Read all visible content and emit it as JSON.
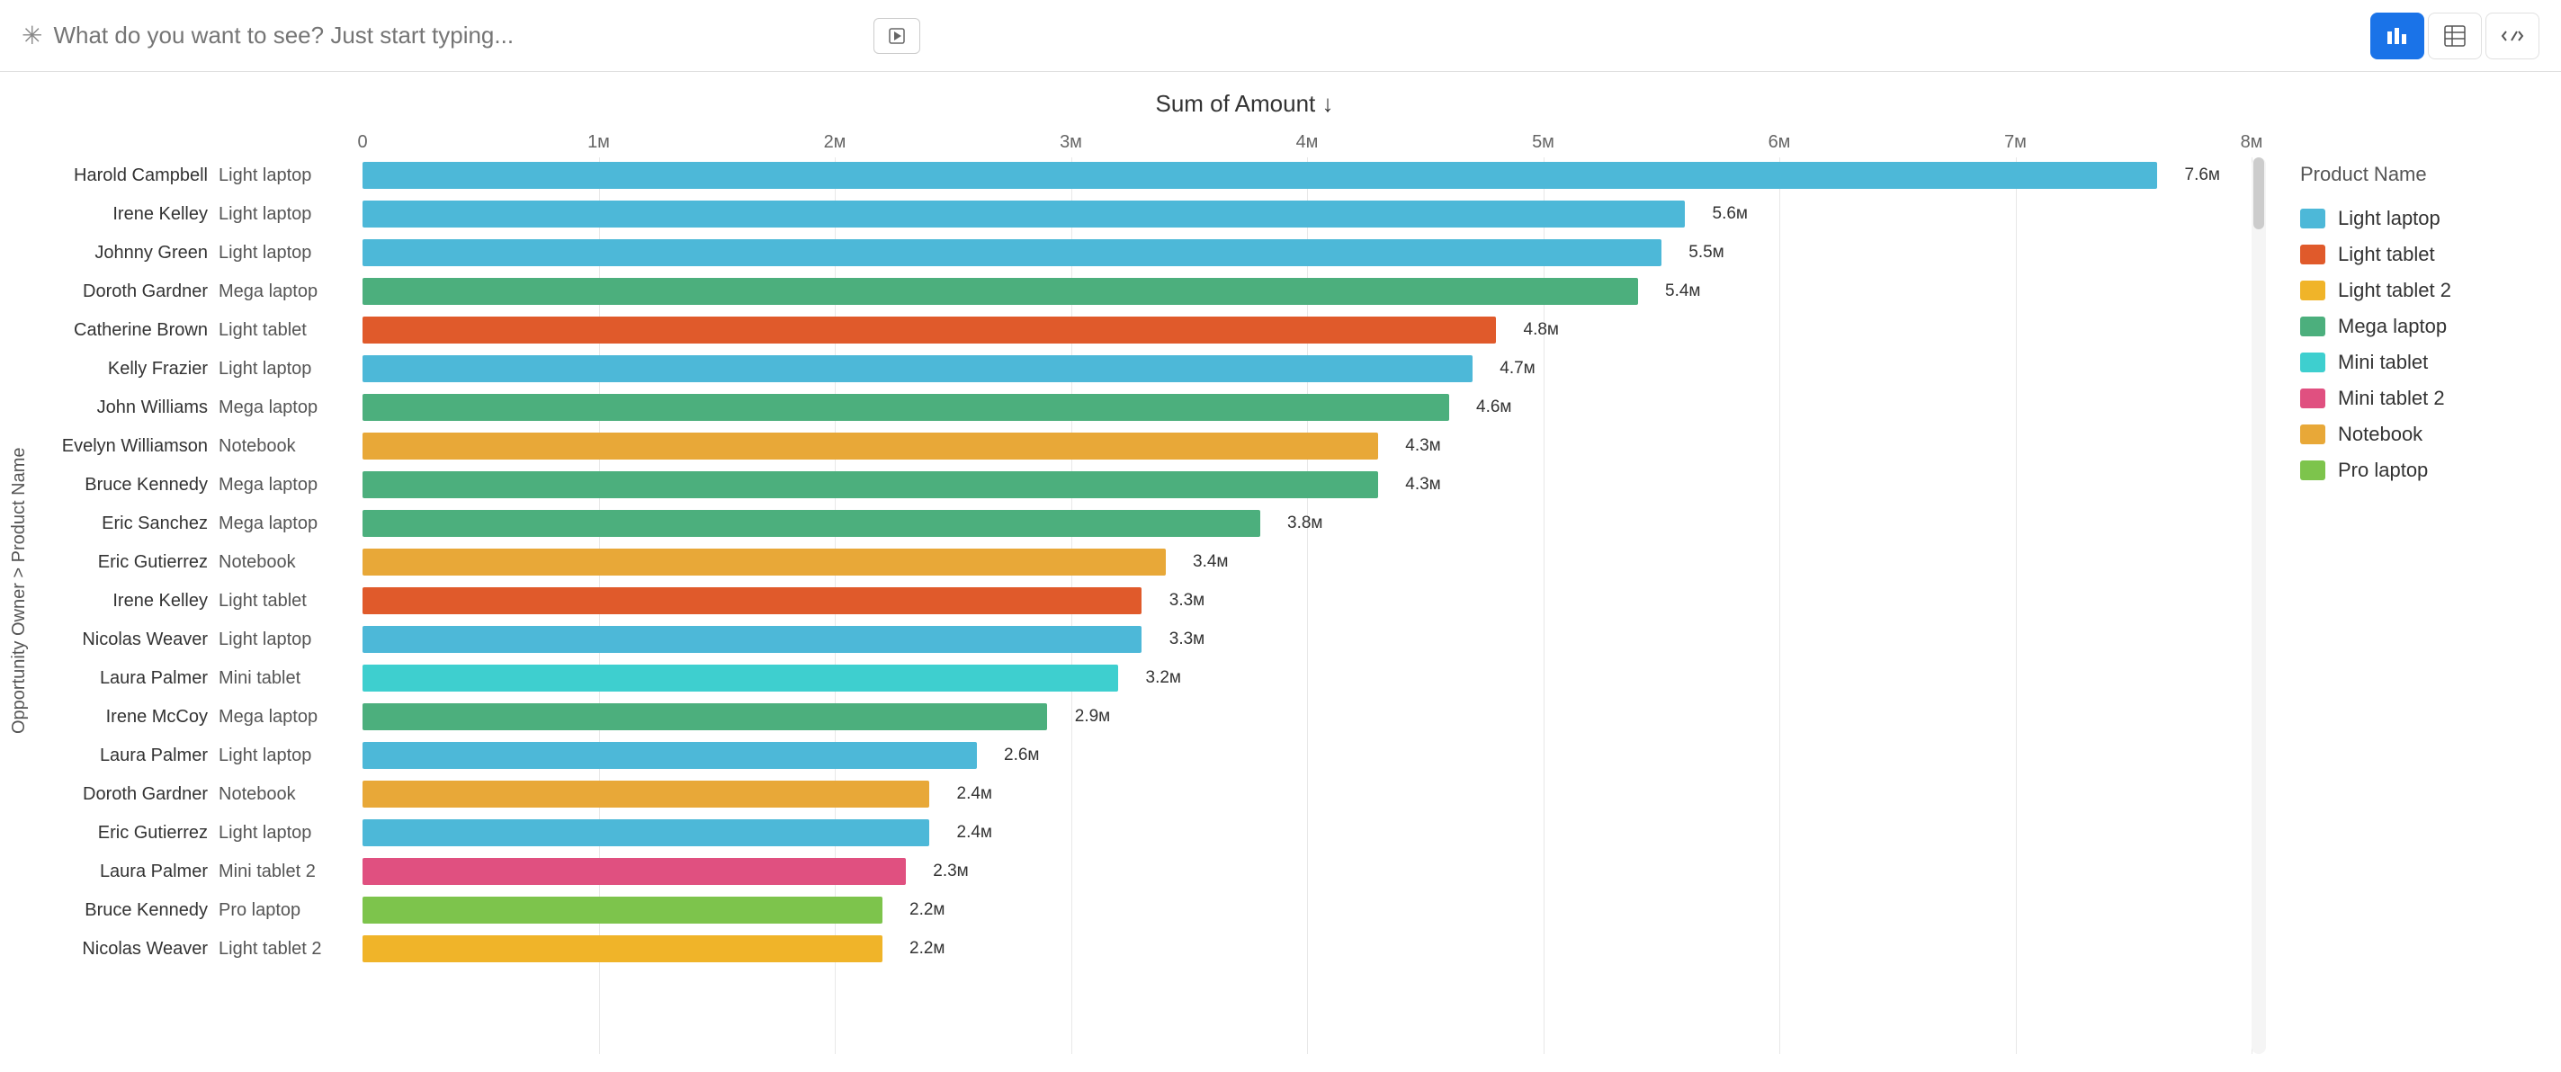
{
  "topBar": {
    "searchPlaceholder": "What do you want to see? Just start typing...",
    "starIcon": "✳",
    "playIcon": "▶",
    "chartIcon": "≡",
    "tableIcon": "⊞",
    "codeIcon": ">_"
  },
  "chart": {
    "title": "Sum of Amount ↓",
    "yAxisLabel": "Opportunity Owner > Product Name",
    "xTicks": [
      "0",
      "1м",
      "2м",
      "3м",
      "4м",
      "5м",
      "6м",
      "7м",
      "8м"
    ],
    "maxValue": 8000000,
    "bars": [
      {
        "name": "Harold Campbell",
        "product": "Light laptop",
        "value": 7600000,
        "label": "7.6м",
        "color": "#4db8d8"
      },
      {
        "name": "Irene Kelley",
        "product": "Light laptop",
        "value": 5600000,
        "label": "5.6м",
        "color": "#4db8d8"
      },
      {
        "name": "Johnny Green",
        "product": "Light laptop",
        "value": 5500000,
        "label": "5.5м",
        "color": "#4db8d8"
      },
      {
        "name": "Doroth Gardner",
        "product": "Mega laptop",
        "value": 5400000,
        "label": "5.4м",
        "color": "#4caf7d"
      },
      {
        "name": "Catherine Brown",
        "product": "Light tablet",
        "value": 4800000,
        "label": "4.8м",
        "color": "#e05a2b"
      },
      {
        "name": "Kelly Frazier",
        "product": "Light laptop",
        "value": 4700000,
        "label": "4.7м",
        "color": "#4db8d8"
      },
      {
        "name": "John Williams",
        "product": "Mega laptop",
        "value": 4600000,
        "label": "4.6м",
        "color": "#4caf7d"
      },
      {
        "name": "Evelyn Williamson",
        "product": "Notebook",
        "value": 4300000,
        "label": "4.3м",
        "color": "#e8a838"
      },
      {
        "name": "Bruce Kennedy",
        "product": "Mega laptop",
        "value": 4300000,
        "label": "4.3м",
        "color": "#4caf7d"
      },
      {
        "name": "Eric Sanchez",
        "product": "Mega laptop",
        "value": 3800000,
        "label": "3.8м",
        "color": "#4caf7d"
      },
      {
        "name": "Eric Gutierrez",
        "product": "Notebook",
        "value": 3400000,
        "label": "3.4м",
        "color": "#e8a838"
      },
      {
        "name": "Irene Kelley",
        "product": "Light tablet",
        "value": 3300000,
        "label": "3.3м",
        "color": "#e05a2b"
      },
      {
        "name": "Nicolas Weaver",
        "product": "Light laptop",
        "value": 3300000,
        "label": "3.3м",
        "color": "#4db8d8"
      },
      {
        "name": "Laura Palmer",
        "product": "Mini tablet",
        "value": 3200000,
        "label": "3.2м",
        "color": "#3ecfcf"
      },
      {
        "name": "Irene McCoy",
        "product": "Mega laptop",
        "value": 2900000,
        "label": "2.9м",
        "color": "#4caf7d"
      },
      {
        "name": "Laura Palmer",
        "product": "Light laptop",
        "value": 2600000,
        "label": "2.6м",
        "color": "#4db8d8"
      },
      {
        "name": "Doroth Gardner",
        "product": "Notebook",
        "value": 2400000,
        "label": "2.4м",
        "color": "#e8a838"
      },
      {
        "name": "Eric Gutierrez",
        "product": "Light laptop",
        "value": 2400000,
        "label": "2.4м",
        "color": "#4db8d8"
      },
      {
        "name": "Laura Palmer",
        "product": "Mini tablet 2",
        "value": 2300000,
        "label": "2.3м",
        "color": "#e05080"
      },
      {
        "name": "Bruce Kennedy",
        "product": "Pro laptop",
        "value": 2200000,
        "label": "2.2м",
        "color": "#7dc44c"
      },
      {
        "name": "Nicolas Weaver",
        "product": "Light tablet 2",
        "value": 2200000,
        "label": "2.2м",
        "color": "#f0b429"
      }
    ],
    "legend": {
      "title": "Product Name",
      "items": [
        {
          "name": "Light laptop",
          "color": "#4db8d8"
        },
        {
          "name": "Light tablet",
          "color": "#e05a2b"
        },
        {
          "name": "Light tablet 2",
          "color": "#f0b429"
        },
        {
          "name": "Mega laptop",
          "color": "#4caf7d"
        },
        {
          "name": "Mini tablet",
          "color": "#3ecfcf"
        },
        {
          "name": "Mini tablet 2",
          "color": "#e05080"
        },
        {
          "name": "Notebook",
          "color": "#e8a838"
        },
        {
          "name": "Pro laptop",
          "color": "#7dc44c"
        }
      ]
    }
  }
}
